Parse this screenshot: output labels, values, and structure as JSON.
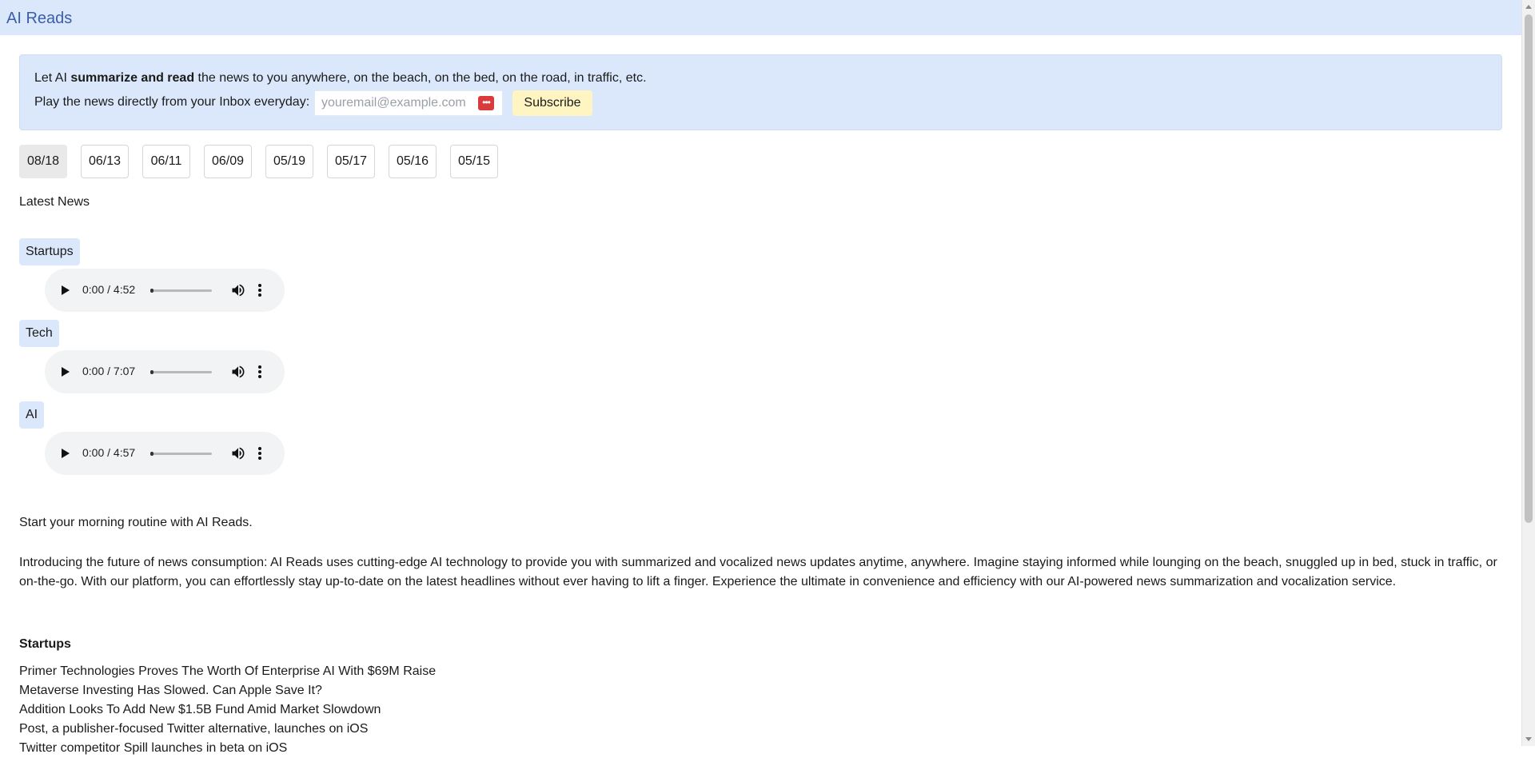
{
  "app": {
    "title": "AI Reads"
  },
  "promo": {
    "line1_prefix": "Let AI ",
    "line1_bold": "summarize and read",
    "line1_suffix": " the news to you anywhere, on the beach, on the bed, on the road, in traffic, etc.",
    "line2": "Play the news directly from your Inbox everyday:",
    "email_placeholder": "youremail@example.com",
    "subscribe_label": "Subscribe"
  },
  "dates": [
    "08/18",
    "06/13",
    "06/11",
    "06/09",
    "05/19",
    "05/17",
    "05/16",
    "05/15"
  ],
  "selected_date": "08/18",
  "latest_label": "Latest News",
  "categories": [
    {
      "label": "Startups",
      "time": "0:00 / 4:52"
    },
    {
      "label": "Tech",
      "time": "0:00 / 7:07"
    },
    {
      "label": "AI",
      "time": "0:00 / 4:57"
    }
  ],
  "intro": "Start your morning routine with AI Reads.",
  "description": "Introducing the future of news consumption: AI Reads uses cutting-edge AI technology to provide you with summarized and vocalized news updates anytime, anywhere. Imagine staying informed while lounging on the beach, snuggled up in bed, stuck in traffic, or on-the-go. With our platform, you can effortlessly stay up-to-date on the latest headlines without ever having to lift a finger. Experience the ultimate in convenience and efficiency with our AI-powered news summarization and vocalization service.",
  "section": {
    "title": "Startups",
    "headlines": [
      "Primer Technologies Proves The Worth Of Enterprise AI With $69M Raise",
      "Metaverse Investing Has Slowed. Can Apple Save It?",
      "Addition Looks To Add New $1.5B Fund Amid Market Slowdown",
      "Post, a publisher-focused Twitter alternative, launches on iOS",
      "Twitter competitor Spill launches in beta on iOS"
    ]
  }
}
